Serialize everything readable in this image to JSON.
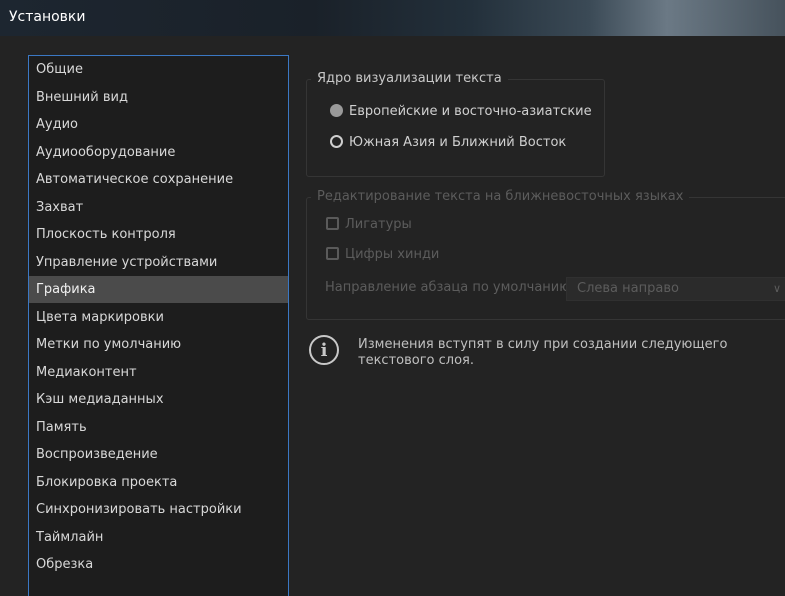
{
  "window": {
    "title": "Установки"
  },
  "categories": [
    "Общие",
    "Внешний вид",
    "Аудио",
    "Аудиооборудование",
    "Автоматическое сохранение",
    "Захват",
    "Плоскость контроля",
    "Управление устройствами",
    "Графика",
    "Цвета маркировки",
    "Метки по умолчанию",
    "Медиаконтент",
    "Кэш медиаданных",
    "Память",
    "Воспроизведение",
    "Блокировка проекта",
    "Синхронизировать настройки",
    "Таймлайн",
    "Обрезка"
  ],
  "selected_category": "Графика",
  "text_engine": {
    "legend": "Ядро визуализации текста",
    "options": [
      {
        "label": "Европейские и восточно-азиатские",
        "checked": true
      },
      {
        "label": "Южная Азия и Ближний Восток",
        "checked": false
      }
    ]
  },
  "middle_east": {
    "legend": "Редактирование текста на ближневосточных языках",
    "ligatures_label": "Лигатуры",
    "hindi_digits_label": "Цифры хинди",
    "direction_label": "Направление абзаца по умолчанию:",
    "direction_value": "Слева направо"
  },
  "info": {
    "icon": "info-icon",
    "message": "Изменения вступят в силу при создании следующего текстового слоя."
  }
}
